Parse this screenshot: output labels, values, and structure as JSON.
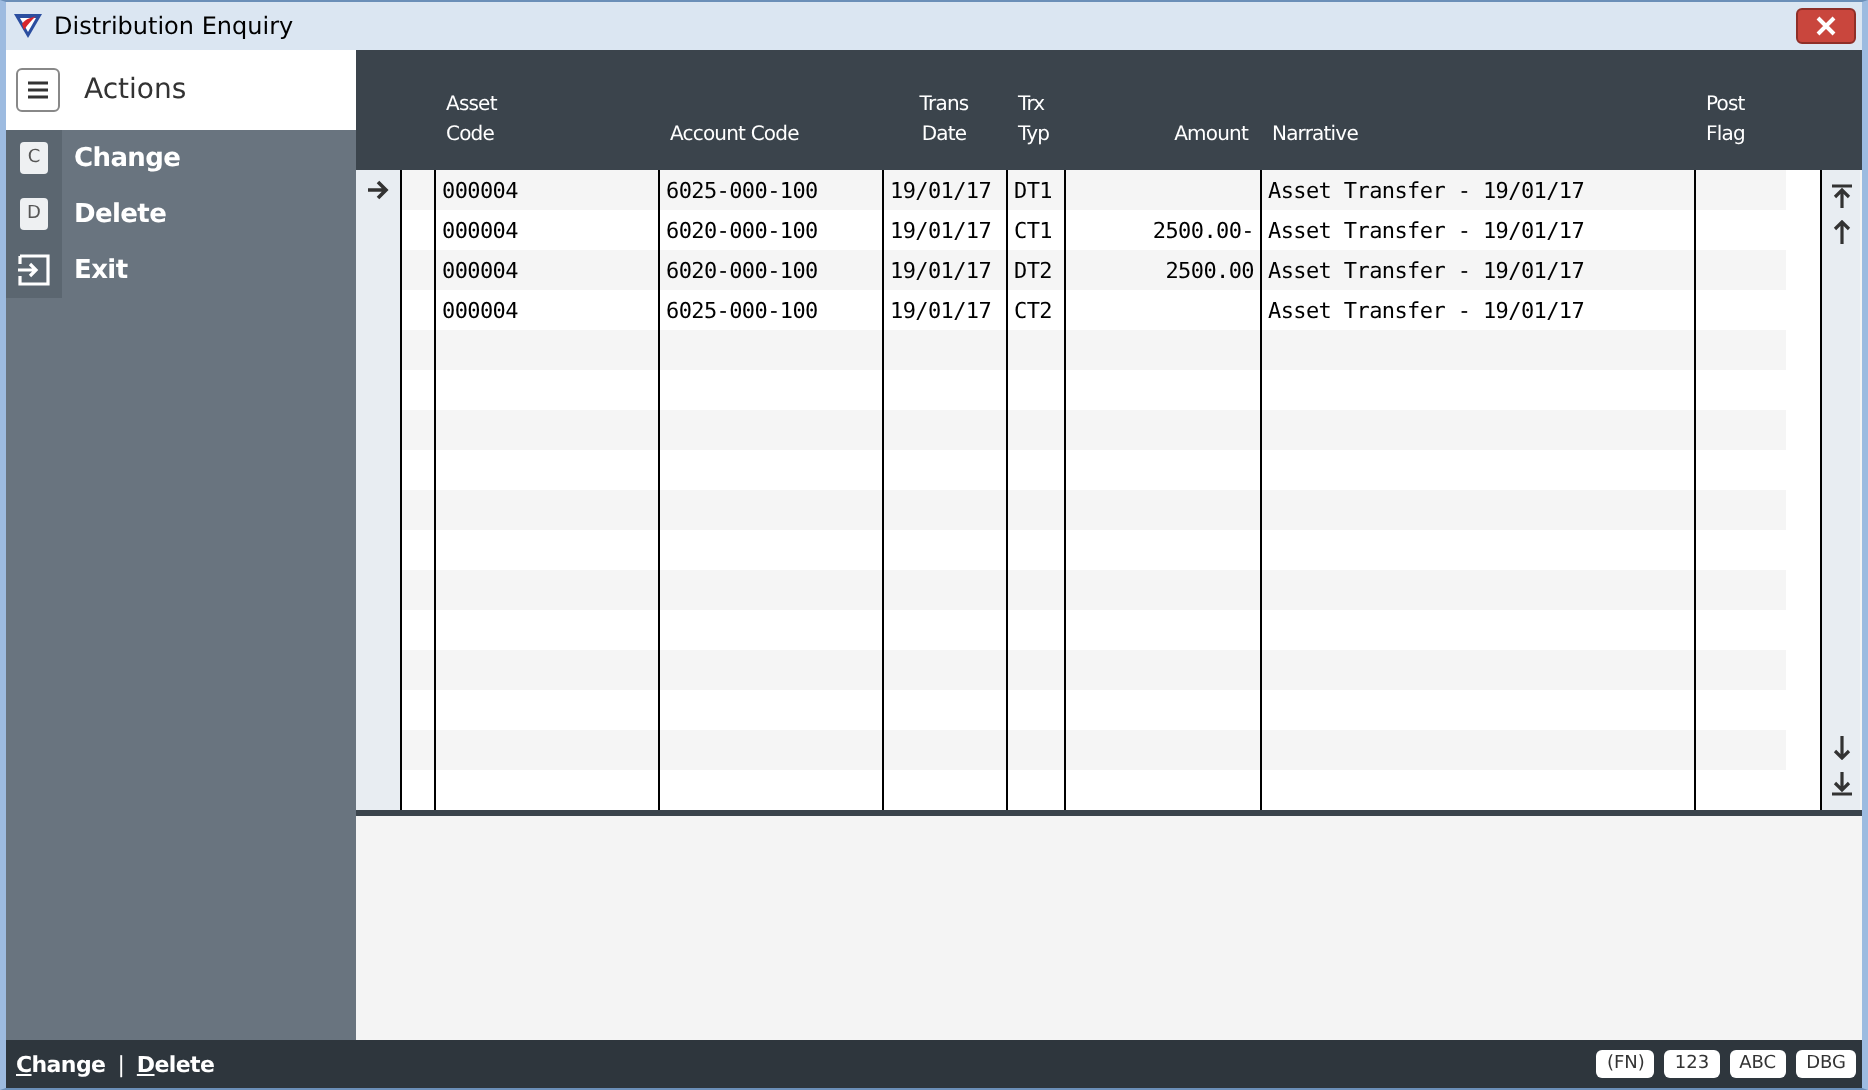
{
  "window": {
    "title": "Distribution Enquiry"
  },
  "sidebar": {
    "title": "Actions",
    "items": [
      {
        "kind": "key",
        "key": "C",
        "label": "Change"
      },
      {
        "kind": "key",
        "key": "D",
        "label": "Delete"
      },
      {
        "kind": "exit",
        "label": "Exit"
      }
    ]
  },
  "table": {
    "columns": [
      {
        "label": "Asset\nCode"
      },
      {
        "label": "Account Code"
      },
      {
        "label": "Trans\nDate"
      },
      {
        "label": "Trx\nTyp"
      },
      {
        "label": "Amount"
      },
      {
        "label": "Narrative"
      },
      {
        "label": "Post\nFlag"
      }
    ],
    "rows": [
      {
        "selected": true,
        "cells": [
          "000004",
          "6025-000-100",
          "19/01/17",
          "DT1",
          "",
          "Asset Transfer - 19/01/17",
          ""
        ]
      },
      {
        "selected": false,
        "cells": [
          "000004",
          "6020-000-100",
          "19/01/17",
          "CT1",
          "2500.00-",
          "Asset Transfer - 19/01/17",
          ""
        ]
      },
      {
        "selected": false,
        "cells": [
          "000004",
          "6020-000-100",
          "19/01/17",
          "DT2",
          "2500.00",
          "Asset Transfer - 19/01/17",
          ""
        ]
      },
      {
        "selected": false,
        "cells": [
          "000004",
          "6025-000-100",
          "19/01/17",
          "CT2",
          "",
          "Asset Transfer - 19/01/17",
          ""
        ]
      }
    ]
  },
  "status_bar": {
    "links": [
      "Change",
      "Delete"
    ],
    "separator": "|",
    "badges": [
      "(FN)",
      "123",
      "ABC",
      "DBG"
    ]
  }
}
